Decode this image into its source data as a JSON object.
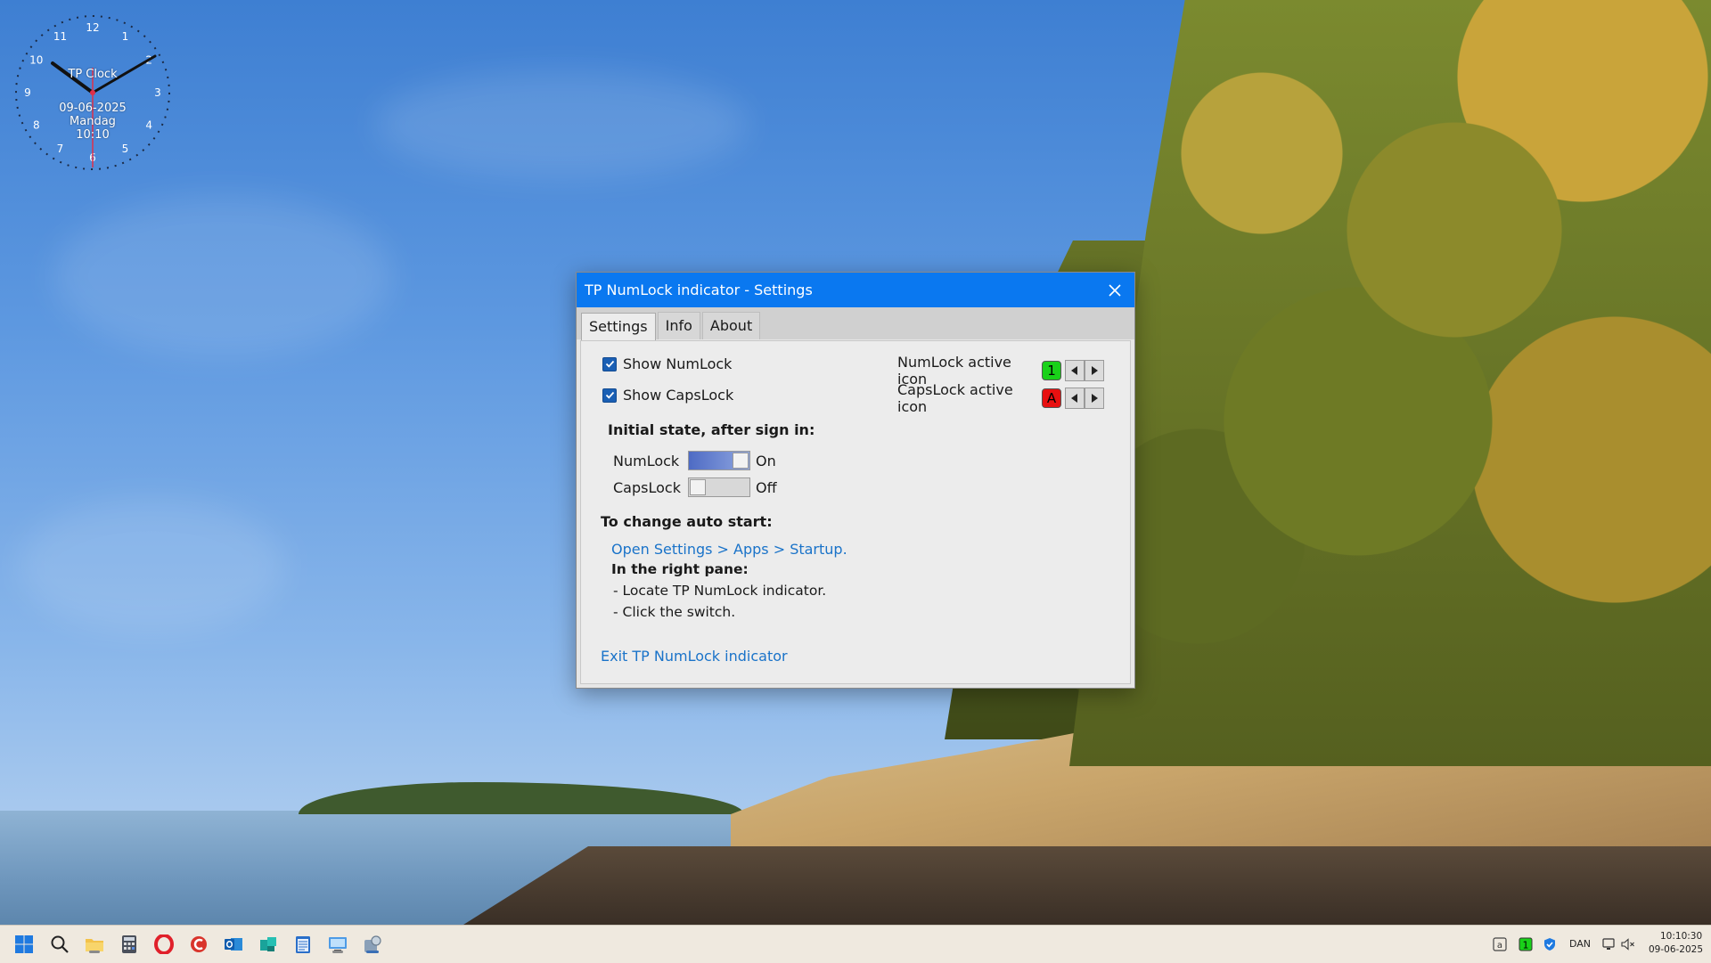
{
  "clock": {
    "title": "TP Clock",
    "date": "09-06-2025",
    "weekday": "Mandag",
    "time": "10:10",
    "numerals": [
      "12",
      "1",
      "2",
      "3",
      "4",
      "5",
      "6",
      "7",
      "8",
      "9",
      "10",
      "11"
    ]
  },
  "dialog": {
    "title": "TP NumLock indicator - Settings",
    "tabs": [
      "Settings",
      "Info",
      "About"
    ],
    "active_tab": "Settings",
    "show_numlock": {
      "label": "Show NumLock",
      "checked": true
    },
    "show_capslock": {
      "label": "Show CapsLock",
      "checked": true
    },
    "numlock_icon": {
      "label": "NumLock active icon",
      "glyph": "1",
      "color": "#19d119"
    },
    "capslock_icon": {
      "label": "CapsLock active icon",
      "glyph": "A",
      "color": "#e81010"
    },
    "initial_state_heading": "Initial state, after sign in:",
    "numlock_toggle": {
      "label": "NumLock",
      "state": "On"
    },
    "capslock_toggle": {
      "label": "CapsLock",
      "state": "Off"
    },
    "autostart_heading": "To change auto start:",
    "open_settings_link": "Open Settings > Apps > Startup.",
    "right_pane_heading": "In the right pane:",
    "step1": "- Locate TP NumLock indicator.",
    "step2": "- Click the switch.",
    "exit_link": "Exit TP NumLock indicator"
  },
  "tray": {
    "language": "DAN",
    "time": "10:10:30",
    "date": "09-06-2025"
  },
  "colors": {
    "titlebar": "#0a78f0",
    "link": "#1a73c9"
  }
}
